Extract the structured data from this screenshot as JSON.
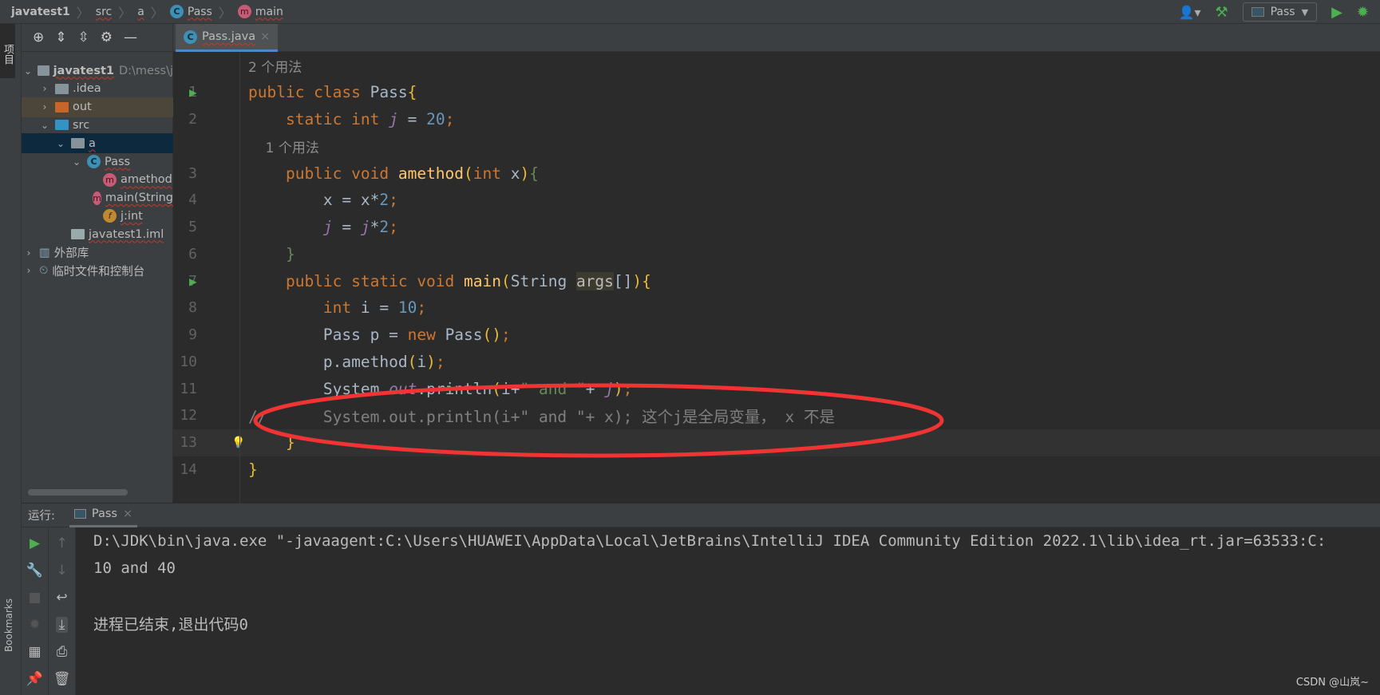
{
  "breadcrumb": [
    "javatest1",
    "src",
    "a",
    "Pass",
    "main"
  ],
  "toolbar": {
    "run_config": "Pass"
  },
  "left_strip": {
    "project_label": "项目",
    "bookmarks_label": "Bookmarks"
  },
  "project_tree": [
    {
      "label": "javatest1",
      "extra": "D:\\mess\\j",
      "depth": 0,
      "arrow": "down",
      "icon": "module-icon"
    },
    {
      "label": ".idea",
      "depth": 1,
      "arrow": "right",
      "icon": "folder-icon"
    },
    {
      "label": "out",
      "depth": 1,
      "arrow": "right",
      "icon": "folder-orange-icon"
    },
    {
      "label": "src",
      "depth": 1,
      "arrow": "down",
      "icon": "folder-blue-icon"
    },
    {
      "label": "a",
      "depth": 2,
      "arrow": "down",
      "icon": "package-icon",
      "selected": true
    },
    {
      "label": "Pass",
      "depth": 3,
      "arrow": "down",
      "icon": "class-icon"
    },
    {
      "label": "amethod",
      "depth": 4,
      "icon": "method-icon"
    },
    {
      "label": "main(String",
      "depth": 4,
      "icon": "method-icon"
    },
    {
      "label": "j:int",
      "depth": 4,
      "icon": "field-icon"
    },
    {
      "label": "javatest1.iml",
      "depth": 2,
      "icon": "iml-file-icon"
    },
    {
      "label": "外部库",
      "depth": 0,
      "arrow": "right",
      "icon": "library-icon"
    },
    {
      "label": "临时文件和控制台",
      "depth": 0,
      "arrow": "right",
      "icon": "scratch-icon"
    }
  ],
  "editor_tab": "Pass.java",
  "code_lines": [
    {
      "hint": "2 个用法"
    },
    {
      "n": "1",
      "run": true,
      "tokens": [
        [
          "public class ",
          "kw"
        ],
        [
          "Pass",
          "pl"
        ],
        [
          "{",
          "br"
        ]
      ]
    },
    {
      "n": "2",
      "tokens": [
        [
          "    static int ",
          "kw"
        ],
        [
          "j",
          "st"
        ],
        [
          " = ",
          "pl"
        ],
        [
          "20",
          "num-l"
        ],
        [
          ";",
          "kw"
        ]
      ]
    },
    {
      "hint": "    1 个用法"
    },
    {
      "n": "3",
      "tokens": [
        [
          "    public void ",
          "kw"
        ],
        [
          "amethod",
          "fn"
        ],
        [
          "(",
          "br"
        ],
        [
          "int ",
          "kw"
        ],
        [
          "x",
          "pl"
        ],
        [
          ")",
          "br"
        ],
        [
          "{",
          "str"
        ]
      ]
    },
    {
      "n": "4",
      "tokens": [
        [
          "        x",
          "pl"
        ],
        [
          " = ",
          "pl"
        ],
        [
          "x",
          "pl"
        ],
        [
          "*",
          "pl"
        ],
        [
          "2",
          "num-l"
        ],
        [
          ";",
          "kw"
        ]
      ]
    },
    {
      "n": "5",
      "tokens": [
        [
          "        ",
          "pl"
        ],
        [
          "j",
          "st"
        ],
        [
          " = ",
          "pl"
        ],
        [
          "j",
          "st"
        ],
        [
          "*",
          "pl"
        ],
        [
          "2",
          "num-l"
        ],
        [
          ";",
          "kw"
        ]
      ]
    },
    {
      "n": "6",
      "tokens": [
        [
          "    }",
          "str"
        ]
      ]
    },
    {
      "n": "7",
      "run": true,
      "tokens": [
        [
          "    public static void ",
          "kw"
        ],
        [
          "main",
          "fn"
        ],
        [
          "(",
          "br"
        ],
        [
          "String ",
          "pl"
        ],
        [
          "args",
          "hl"
        ],
        [
          "[]",
          "pl"
        ],
        [
          ")",
          "br"
        ],
        [
          "{",
          "br"
        ]
      ]
    },
    {
      "n": "8",
      "tokens": [
        [
          "        int ",
          "kw"
        ],
        [
          "i = ",
          "pl"
        ],
        [
          "10",
          "num-l"
        ],
        [
          ";",
          "kw"
        ]
      ]
    },
    {
      "n": "9",
      "tokens": [
        [
          "        Pass p = ",
          "pl"
        ],
        [
          "new ",
          "kw"
        ],
        [
          "Pass",
          "pl"
        ],
        [
          "()",
          "br"
        ],
        [
          ";",
          "kw"
        ]
      ]
    },
    {
      "n": "10",
      "tokens": [
        [
          "        p.amethod",
          "pl"
        ],
        [
          "(",
          "br"
        ],
        [
          "i",
          "pl"
        ],
        [
          ")",
          "br"
        ],
        [
          ";",
          "kw"
        ]
      ]
    },
    {
      "n": "11",
      "tokens": [
        [
          "        System.",
          "pl"
        ],
        [
          "out",
          "st"
        ],
        [
          ".println",
          "pl"
        ],
        [
          "(",
          "br"
        ],
        [
          "i+",
          "pl"
        ],
        [
          "\" and \"",
          "str"
        ],
        [
          "+ ",
          "pl"
        ],
        [
          "j",
          "st"
        ],
        [
          ")",
          "br"
        ],
        [
          ";",
          "kw"
        ]
      ]
    },
    {
      "n": "12",
      "tokens": [
        [
          "//      System.out.println(i+\" and \"+ x); 这个j是全局变量， x 不是",
          "cm"
        ]
      ]
    },
    {
      "n": "13",
      "current": true,
      "tokens": [
        [
          "    }",
          "br"
        ]
      ]
    },
    {
      "n": "14",
      "tokens": [
        [
          "}",
          "br"
        ]
      ]
    }
  ],
  "run_panel": {
    "label": "运行:",
    "tab": "Pass",
    "output": [
      "D:\\JDK\\bin\\java.exe \"-javaagent:C:\\Users\\HUAWEI\\AppData\\Local\\JetBrains\\IntelliJ IDEA Community Edition 2022.1\\lib\\idea_rt.jar=63533:C:",
      "10 and 40",
      "",
      "进程已结束,退出代码0"
    ]
  },
  "watermark": "CSDN @山岚~",
  "annotation": {
    "color": "#f03333"
  }
}
